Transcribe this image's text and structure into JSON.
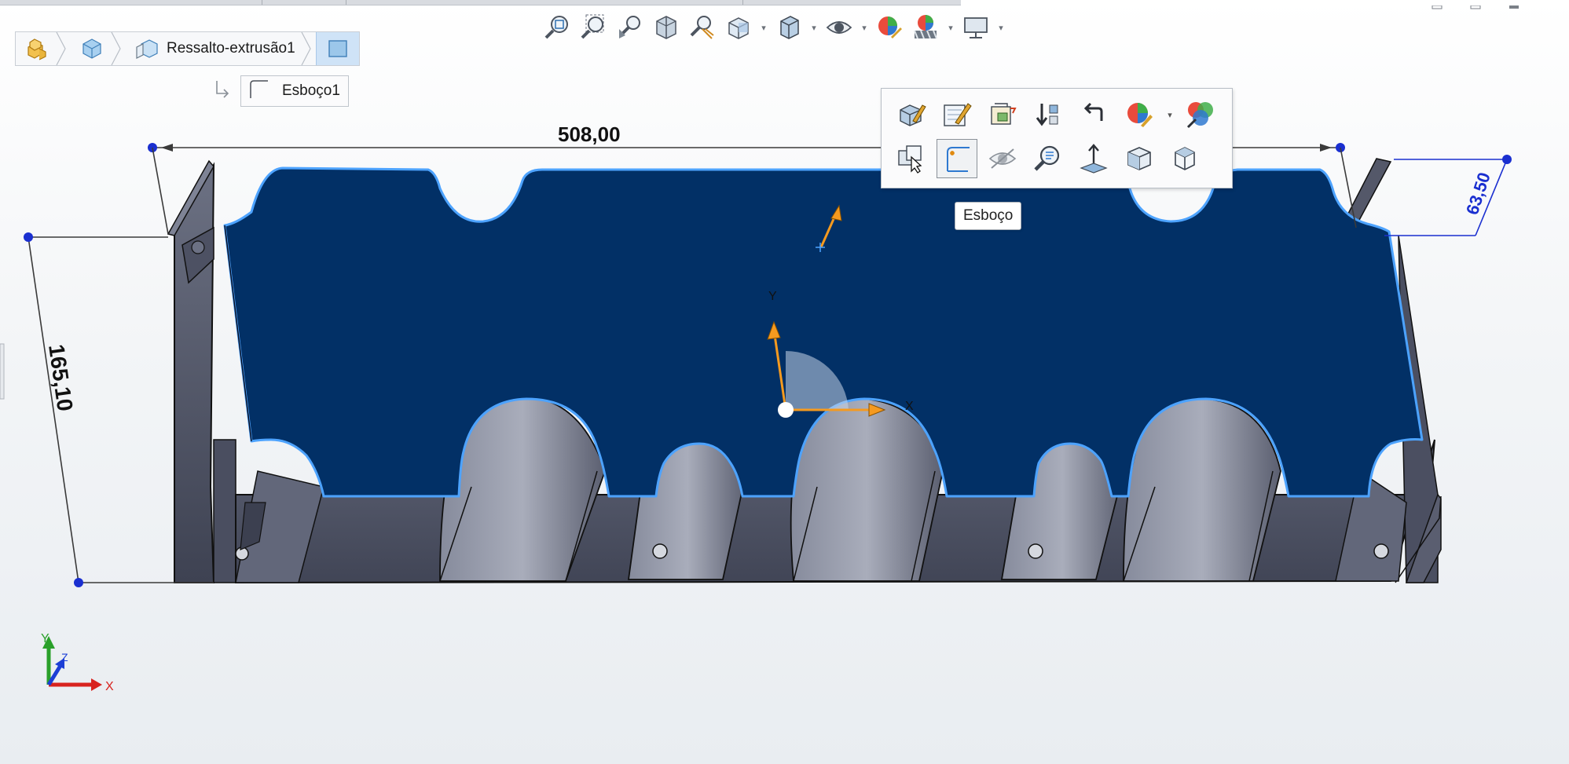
{
  "breadcrumb": {
    "items": [
      {
        "icon": "part-icon"
      },
      {
        "icon": "body-icon"
      },
      {
        "icon": "feature-extrude-icon",
        "label": "Ressalto-extrusão1"
      },
      {
        "icon": "face-icon"
      }
    ],
    "sub_item": {
      "icon": "sketch-icon",
      "label": "Esboço1"
    }
  },
  "heads_up_toolbar": [
    "zoom-to-fit-icon",
    "zoom-to-area-icon",
    "previous-view-icon",
    "section-view-icon",
    "dynamic-annotation-views-icon",
    "view-orientation-icon",
    "display-style-icon",
    "hide-show-items-icon",
    "edit-appearance-icon",
    "apply-scene-icon",
    "view-settings-icon"
  ],
  "context_toolbar": {
    "row1": [
      "edit-feature-icon",
      "edit-sketch-icon",
      "sketch-edit-icon",
      "rollback-icon",
      "parent-child-icon",
      "appearance-icon",
      "appearance-multi-icon"
    ],
    "row2": [
      "select-other-icon",
      "sketch-new-icon",
      "hide-icon",
      "zoom-to-selection-icon",
      "normal-to-icon",
      "view-box-icon",
      "isometric-view-icon"
    ],
    "selected_index": 1,
    "tooltip": "Esboço"
  },
  "model": {
    "face_color": "#023066",
    "body_color": "#5a5f70",
    "edge_highlight": "#4da3ff"
  },
  "dimensions": {
    "width": "508,00",
    "height": "165,10",
    "depth": "63,50"
  },
  "triad": {
    "x": "X",
    "y": "Y",
    "z": "Z"
  },
  "origin_labels": {
    "x": "X",
    "y": "Y"
  }
}
